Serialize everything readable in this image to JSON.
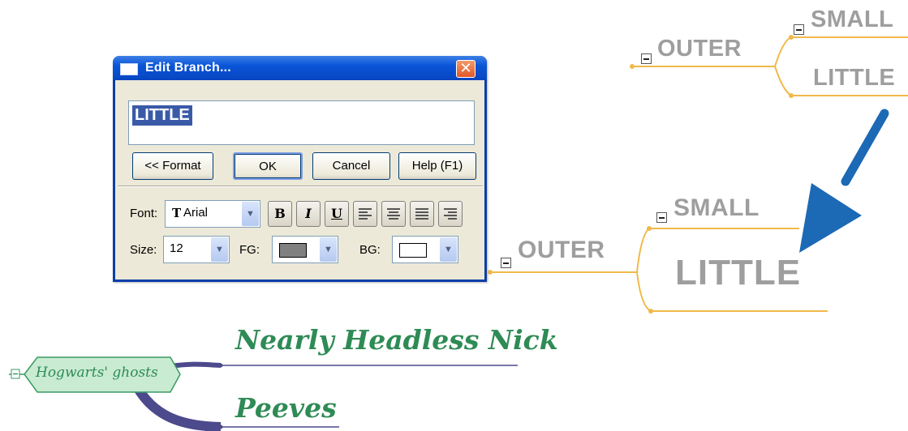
{
  "dialog": {
    "title": "Edit Branch...",
    "close_glyph": "✕",
    "text_value": "LITTLE",
    "buttons": {
      "format": "<< Format",
      "ok": "OK",
      "cancel": "Cancel",
      "help": "Help (F1)"
    },
    "font_label": "Font:",
    "font_value": "Arial",
    "font_type_glyph": "T",
    "format_buttons": {
      "bold": "B",
      "italic": "I",
      "underline": "U"
    },
    "size_label": "Size:",
    "size_value": "12",
    "fg_label": "FG:",
    "bg_label": "BG:",
    "fg_color": "#808080",
    "bg_color": "#ffffff"
  },
  "map_before": {
    "outer": "OUTER",
    "small": "SMALL",
    "little": "LITTLE"
  },
  "map_after": {
    "outer": "OUTER",
    "small": "SMALL",
    "little": "LITTLE"
  },
  "ghosts_map": {
    "root": "Hogwarts' ghosts",
    "branches": [
      "Nearly Headless Nick",
      "Peeves"
    ]
  },
  "colors": {
    "branch_line": "#f0b94a",
    "map_text": "#9e9e9e",
    "arrow": "#1c69b5",
    "ghost_root_fill": "#c9ebd2",
    "ghost_text": "#2e8b55",
    "ghost_curve": "#4c4a8c"
  },
  "icons": [
    "close-icon",
    "window-icon",
    "collapse-icon",
    "arrow-icon",
    "dropdown-arrow-icon"
  ]
}
